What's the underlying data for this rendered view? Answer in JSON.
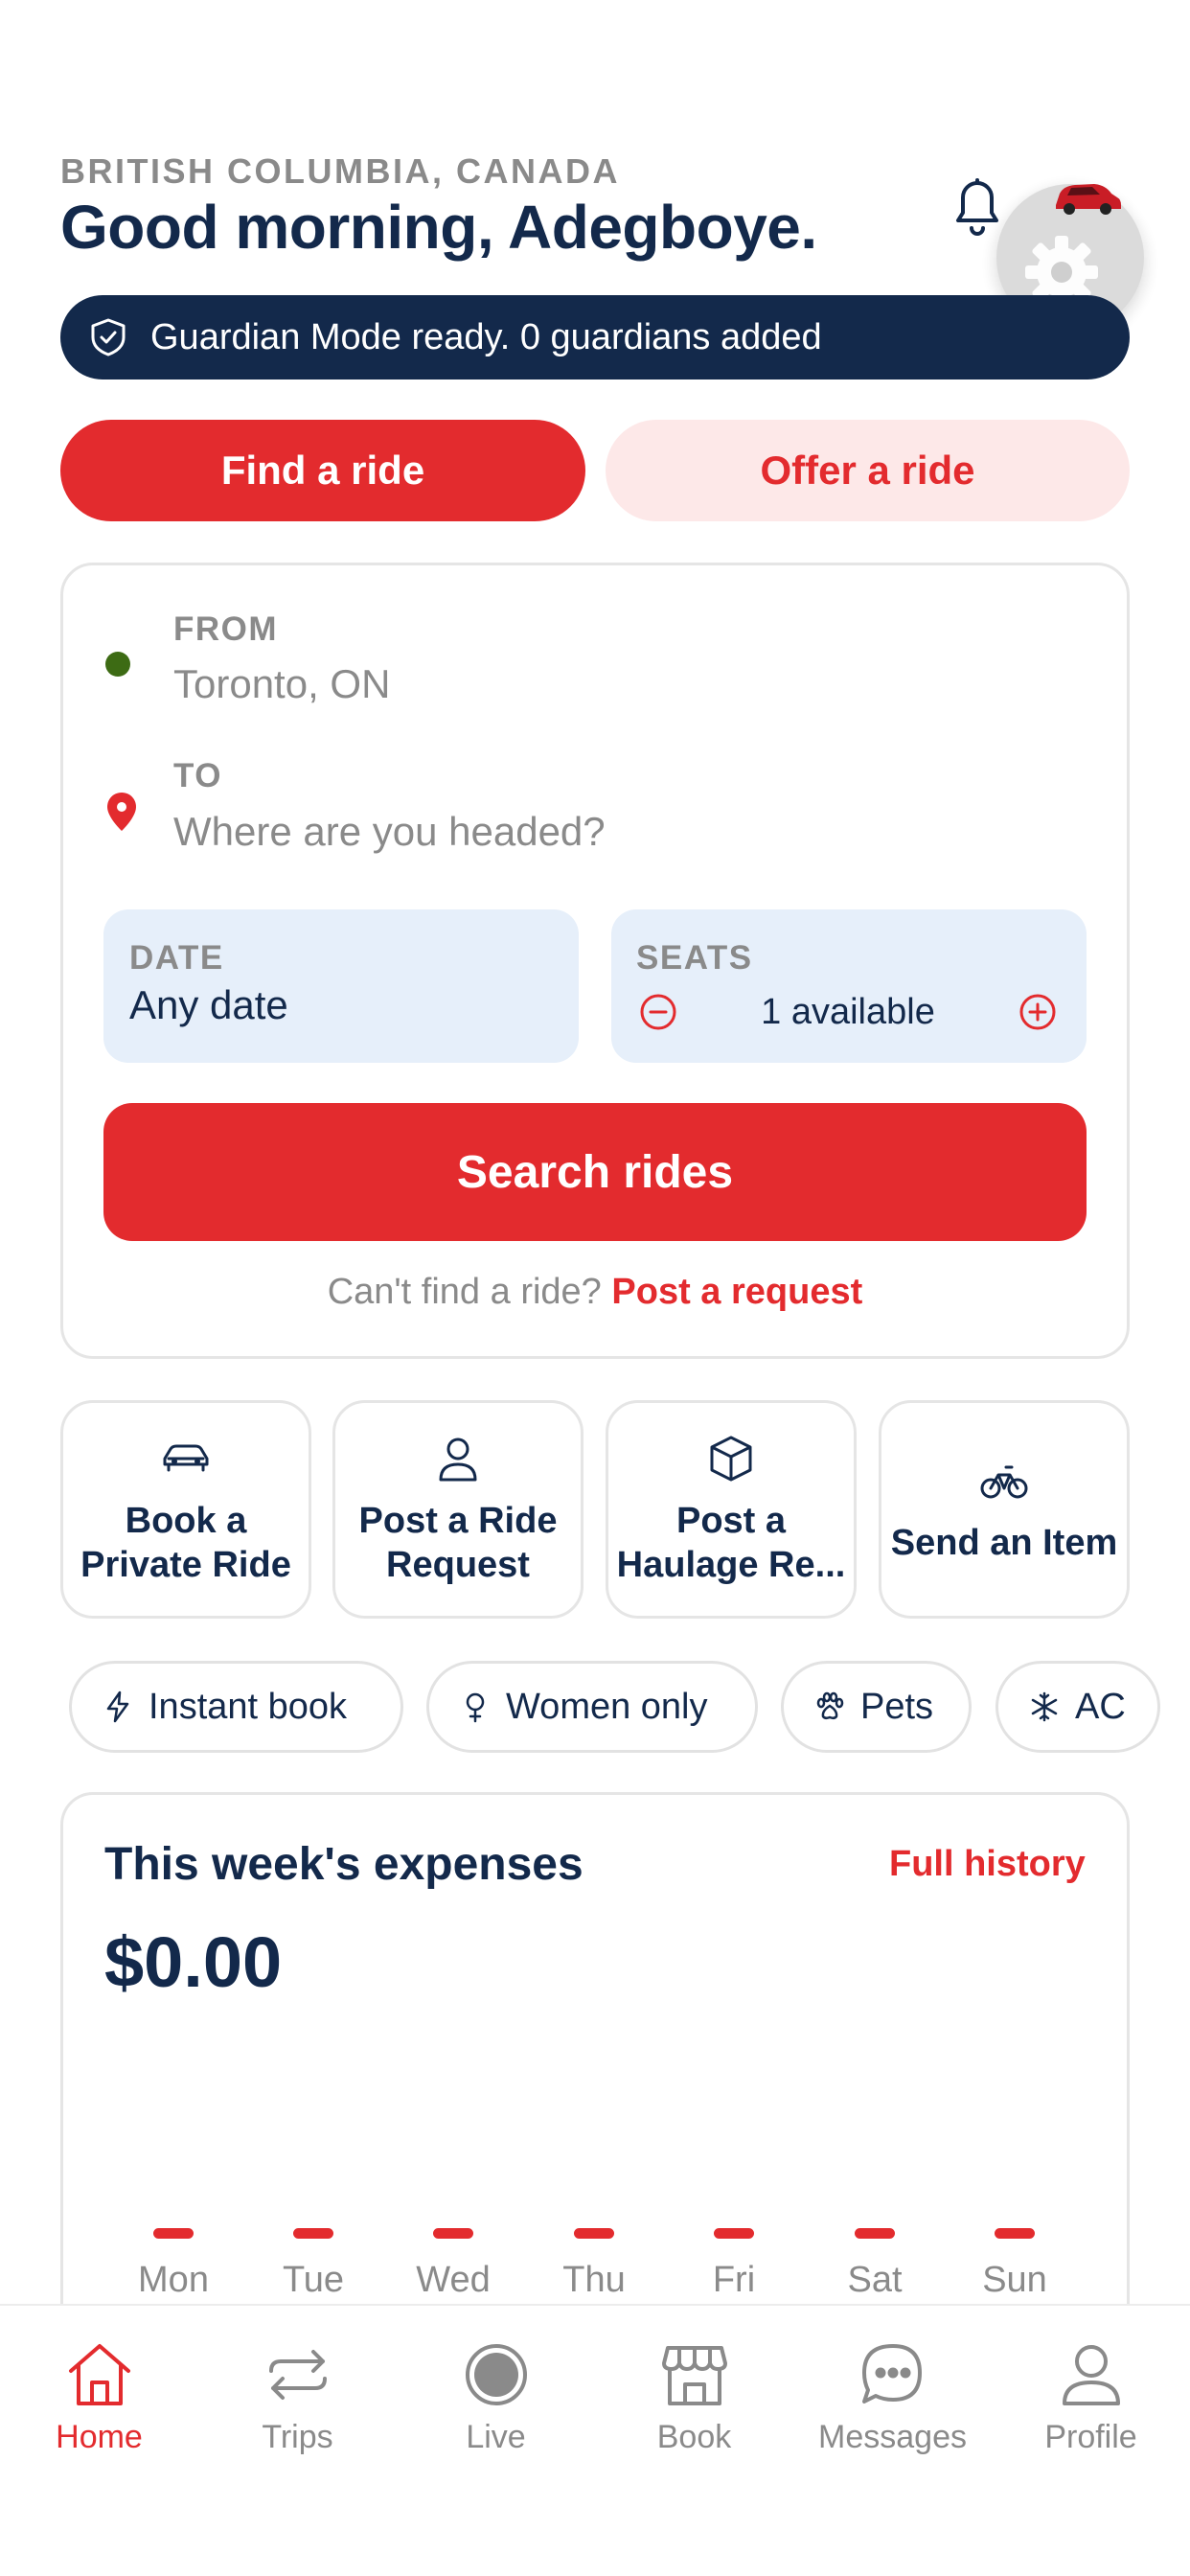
{
  "header": {
    "region": "BRITISH COLUMBIA, CANADA",
    "greeting": "Good morning, Adegboye."
  },
  "guardian_banner": {
    "text": "Guardian Mode ready. 0 guardians added"
  },
  "mode_tabs": {
    "find_label": "Find a ride",
    "offer_label": "Offer a ride"
  },
  "search": {
    "from_label": "FROM",
    "from_value": "Toronto, ON",
    "to_label": "TO",
    "to_placeholder": "Where are you headed?",
    "date_label": "DATE",
    "date_value": "Any date",
    "seats_label": "SEATS",
    "seats_value": "1 available",
    "search_button": "Search rides",
    "cant_find_text": "Can't find a ride?",
    "post_request_link": "Post a request"
  },
  "quick_actions": [
    {
      "label": "Book a\nPrivate Ride",
      "icon": "car-icon"
    },
    {
      "label": "Post a Ride\nRequest",
      "icon": "person-icon"
    },
    {
      "label": "Post a\nHaulage Re...",
      "icon": "box-icon"
    },
    {
      "label": "Send an Item",
      "icon": "bicycle-icon"
    }
  ],
  "filters": [
    {
      "label": "Instant book",
      "icon": "bolt-icon"
    },
    {
      "label": "Women only",
      "icon": "female-icon"
    },
    {
      "label": "Pets",
      "icon": "paw-icon"
    },
    {
      "label": "AC",
      "icon": "snowflake-icon"
    }
  ],
  "expenses": {
    "title": "This week's expenses",
    "history_link": "Full history",
    "total": "$0.00",
    "days": [
      "Mon",
      "Tue",
      "Wed",
      "Thu",
      "Fri",
      "Sat",
      "Sun"
    ],
    "values": [
      0,
      0,
      0,
      0,
      0,
      0,
      0
    ]
  },
  "nav": [
    {
      "label": "Home",
      "icon": "home-icon",
      "active": true
    },
    {
      "label": "Trips",
      "icon": "repeat-icon",
      "active": false
    },
    {
      "label": "Live",
      "icon": "live-icon",
      "active": false
    },
    {
      "label": "Book",
      "icon": "store-icon",
      "active": false
    },
    {
      "label": "Messages",
      "icon": "chat-icon",
      "active": false
    },
    {
      "label": "Profile",
      "icon": "user-icon",
      "active": false
    }
  ],
  "colors": {
    "brand_red": "#e32b2e",
    "navy": "#13294b",
    "light_blue": "#e6effa",
    "muted": "#8a8a8a",
    "from_dot": "#3d6b14"
  }
}
